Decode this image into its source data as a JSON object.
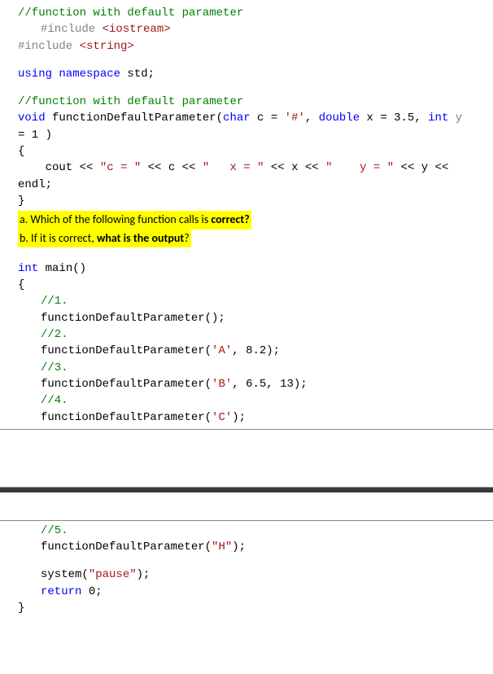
{
  "top": {
    "comment_title": "//function with default parameter",
    "include1_dir": "#include ",
    "include1_hdr": "<iostream>",
    "include2_dir": "#include ",
    "include2_hdr": "<string>",
    "using_kw": "using namespace",
    "using_rest": " std;",
    "comment_fn": "//function with default parameter",
    "fn_void": "void",
    "fn_sig1": " functionDefaultParameter(",
    "fn_char": "char",
    "fn_sig2": " c = ",
    "fn_hash": "'#'",
    "fn_sig3": ", ",
    "fn_double": "double",
    "fn_sig4": " x = 3.5, ",
    "fn_int": "int",
    "fn_sig5": " y",
    "fn_line2": "= 1 )",
    "brace_open": "{",
    "cout_line_a": "    cout << ",
    "cout_str1": "\"c = \"",
    "cout_mid1": " << c << ",
    "cout_str2": "\"   x = \"",
    "cout_mid2": " << x << ",
    "cout_str3": "\"    y = \"",
    "cout_mid3": " << y <<",
    "endl": "endl;",
    "brace_close": "}"
  },
  "questions": {
    "a_pre": "a.   Which of the following function calls is ",
    "a_bold": "correct?",
    "b_pre": "b.   If it is correct, ",
    "b_bold": "what is the output",
    "b_post": "?"
  },
  "main1": {
    "int": "int",
    "main_sig": " main()",
    "brace_open": "{",
    "c1": "//1.",
    "l1": "functionDefaultParameter();",
    "c2": "//2.",
    "l2a": "functionDefaultParameter(",
    "l2b": "'A'",
    "l2c": ", 8.2);",
    "c3": "//3.",
    "l3a": "functionDefaultParameter(",
    "l3b": "'B'",
    "l3c": ", 6.5, 13);",
    "c4": "//4.",
    "l4a": "functionDefaultParameter(",
    "l4b": "'C'",
    "l4c": ");"
  },
  "main2": {
    "c5": "//5.",
    "l5a": "functionDefaultParameter(",
    "l5b": "\"H\"",
    "l5c": ");",
    "sys_a": "system(",
    "sys_b": "\"pause\"",
    "sys_c": ");",
    "ret_kw": "return",
    "ret_rest": " 0;",
    "brace_close": "}"
  }
}
